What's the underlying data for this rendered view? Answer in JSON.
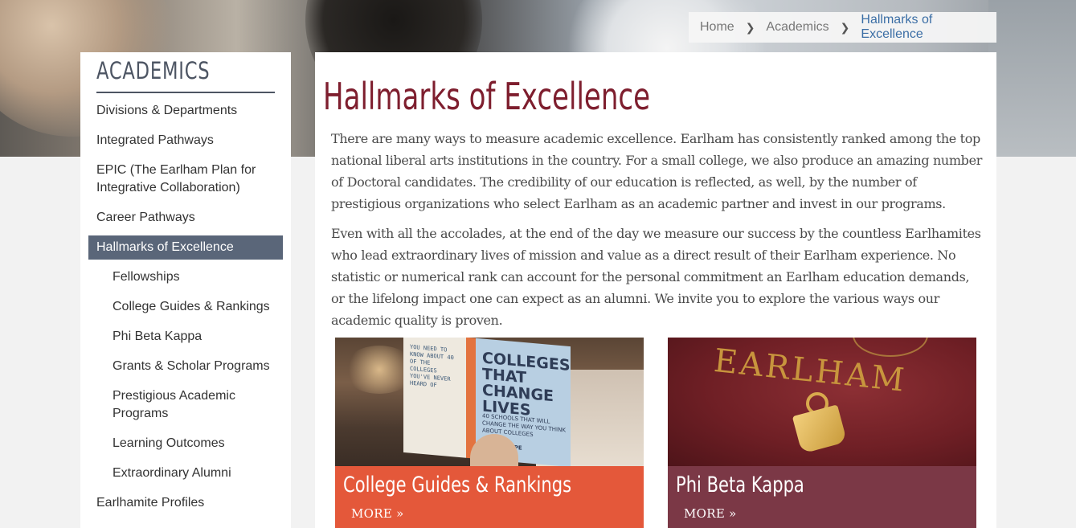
{
  "breadcrumb": {
    "items": [
      {
        "label": "Home"
      },
      {
        "label": "Academics"
      },
      {
        "label": "Hallmarks of Excellence"
      }
    ],
    "separator_icon": "chevron-right-icon"
  },
  "sidebar": {
    "title": "ACADEMICS",
    "items": [
      {
        "label": "Divisions & Departments",
        "level": 1
      },
      {
        "label": "Integrated Pathways",
        "level": 1
      },
      {
        "label": "EPIC (The Earlham Plan for Integrative Collaboration)",
        "level": 1
      },
      {
        "label": "Career Pathways",
        "level": 1
      },
      {
        "label": "Hallmarks of Excellence",
        "level": 1,
        "active": true
      },
      {
        "label": "Fellowships",
        "level": 2
      },
      {
        "label": "College Guides & Rankings",
        "level": 2
      },
      {
        "label": "Phi Beta Kappa",
        "level": 2
      },
      {
        "label": "Grants & Scholar Programs",
        "level": 2
      },
      {
        "label": "Prestigious Academic Programs",
        "level": 2
      },
      {
        "label": "Learning Outcomes",
        "level": 2
      },
      {
        "label": "Extraordinary Alumni",
        "level": 2
      },
      {
        "label": "Earlhamite Profiles",
        "level": 1
      }
    ]
  },
  "main": {
    "title": "Hallmarks of Excellence",
    "paragraphs": [
      "There are many ways to measure academic excellence. Earlham has consistently ranked among the top national liberal arts institutions in the country. For a small college, we also produce an amazing number of Doctoral candidates. The credibility of our education is reflected, as well, by the number of prestigious organizations who select Earlham as an academic partner and invest in our programs.",
      "Even with all the accolades, at the end of the day we measure our success by the countless Earlhamites who lead extraordinary lives of mission and value as a direct result of their Earlham experience. No statistic or numerical rank can account for the personal commitment an Earlham education demands, or the lifelong impact one can expect as an alumni. We invite you to explore the various ways our academic quality is proven."
    ]
  },
  "cards": [
    {
      "title": "College Guides & Rankings",
      "more": "MORE »",
      "band_color": "#e4583a",
      "book": {
        "cover": "COLLEGES THAT CHANGE LIVES",
        "cover_sub": "40 SCHOOLS THAT WILL CHANGE THE WAY YOU THINK ABOUT COLLEGES",
        "author": "LOREN POPE",
        "page_text": "YOU NEED TO KNOW ABOUT 40 OF THE COLLEGES YOU'VE NEVER HEARD OF"
      }
    },
    {
      "title": "Phi Beta Kappa",
      "more": "MORE »",
      "band_color": "#7b3846",
      "emblem_text": "EARLHAM"
    }
  ],
  "colors": {
    "title_maroon": "#7e1e2e",
    "nav_active": "#5a6679",
    "link_blue": "#3b6ea5"
  }
}
